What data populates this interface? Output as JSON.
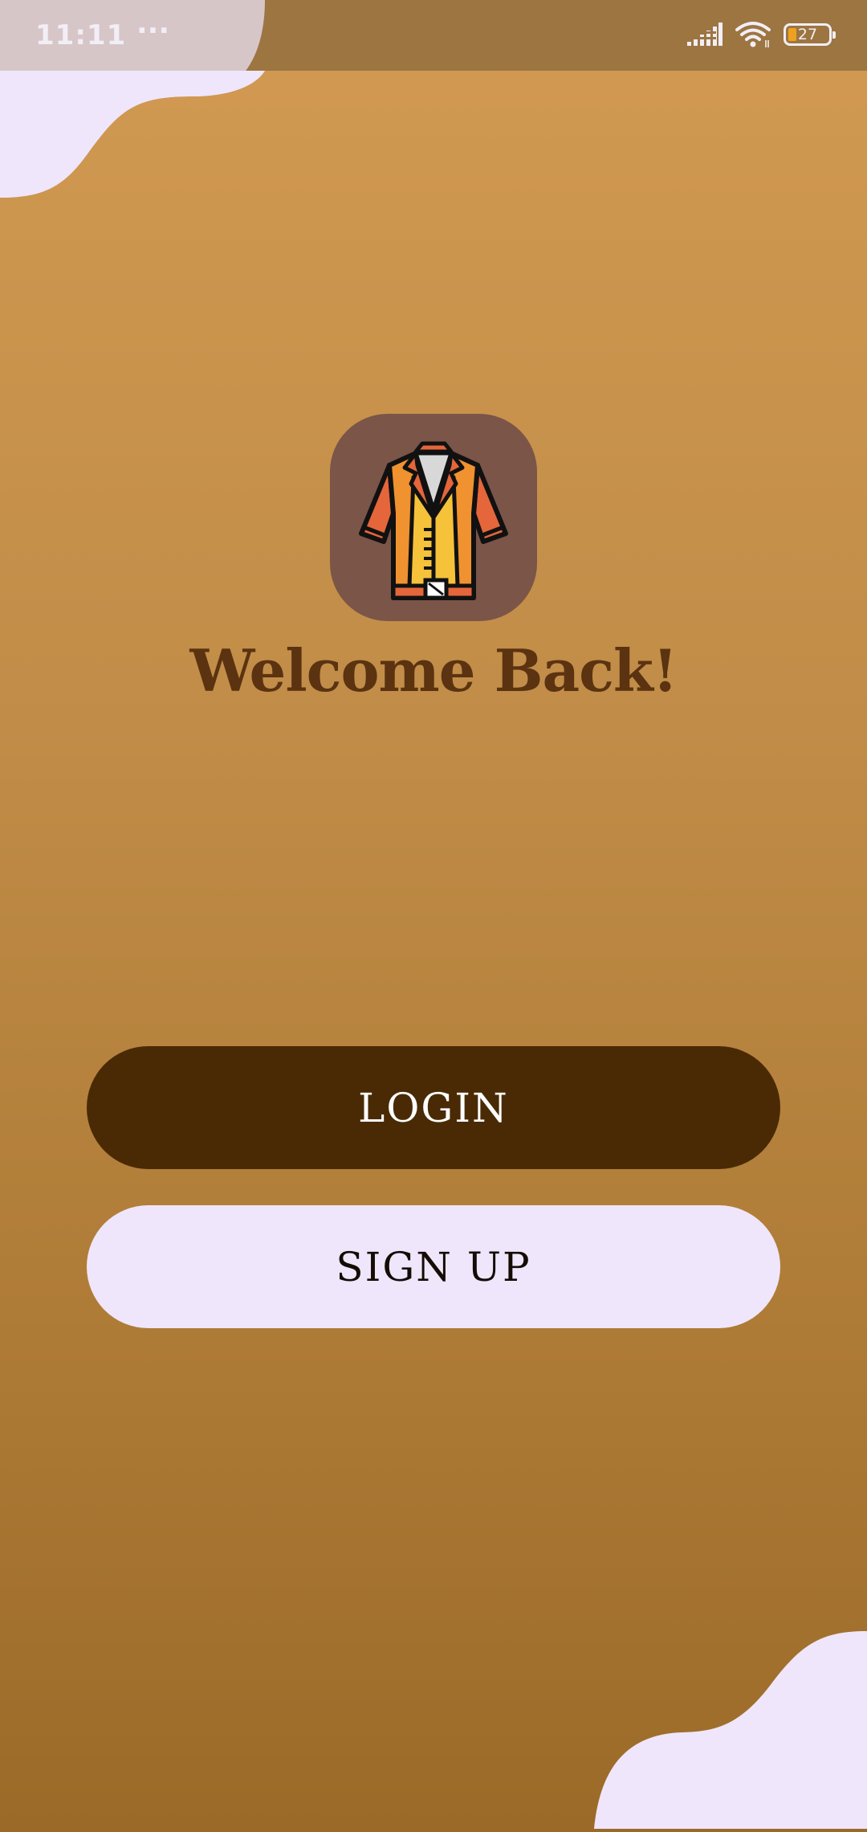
{
  "status_bar": {
    "time": "11:11",
    "dots": "···",
    "battery_level": "27"
  },
  "welcome": {
    "title": "Welcome Back!"
  },
  "buttons": {
    "login": "LOGIN",
    "signup": "SIGN UP"
  },
  "icons": {
    "logo": "jacket-icon",
    "signal": "signal-icon",
    "wifi": "wifi-icon",
    "battery": "battery-icon"
  },
  "colors": {
    "background_top": "#d29a52",
    "background_bottom": "#9b6a28",
    "status_bar": "#9c7541",
    "blob": "#efe6fc",
    "logo_bg": "#7b5548",
    "title": "#5b3311",
    "login_button": "#4a2a05",
    "signup_button": "#efe6fc"
  }
}
